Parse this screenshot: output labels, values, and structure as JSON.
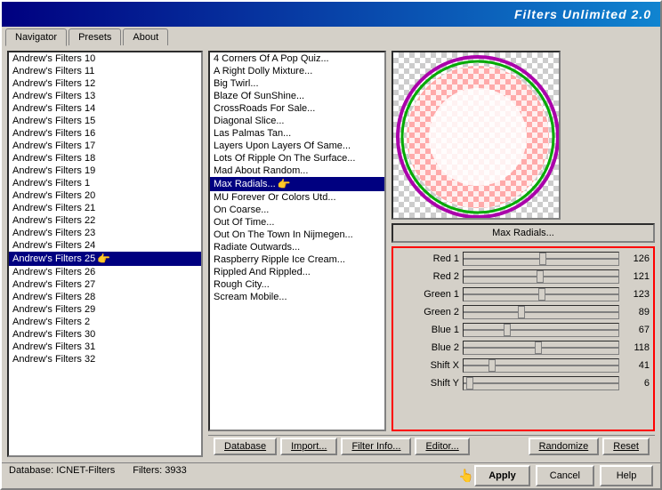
{
  "title": "Filters Unlimited 2.0",
  "tabs": [
    {
      "id": "navigator",
      "label": "Navigator"
    },
    {
      "id": "presets",
      "label": "Presets"
    },
    {
      "id": "about",
      "label": "About"
    }
  ],
  "activeTab": "navigator",
  "leftList": {
    "items": [
      {
        "label": "Andrew's Filters 10",
        "hasArrow": false
      },
      {
        "label": "Andrew's Filters 11",
        "hasArrow": false
      },
      {
        "label": "Andrew's Filters 12",
        "hasArrow": false
      },
      {
        "label": "Andrew's Filters 13",
        "hasArrow": false
      },
      {
        "label": "Andrew's Filters 14",
        "hasArrow": false
      },
      {
        "label": "Andrew's Filters 15",
        "hasArrow": false
      },
      {
        "label": "Andrew's Filters 16",
        "hasArrow": false
      },
      {
        "label": "Andrew's Filters 17",
        "hasArrow": false
      },
      {
        "label": "Andrew's Filters 18",
        "hasArrow": false
      },
      {
        "label": "Andrew's Filters 19",
        "hasArrow": false
      },
      {
        "label": "Andrew's Filters 1",
        "hasArrow": false
      },
      {
        "label": "Andrew's Filters 20",
        "hasArrow": false
      },
      {
        "label": "Andrew's Filters 21",
        "hasArrow": false
      },
      {
        "label": "Andrew's Filters 22",
        "hasArrow": false
      },
      {
        "label": "Andrew's Filters 23",
        "hasArrow": false
      },
      {
        "label": "Andrew's Filters 24",
        "hasArrow": false
      },
      {
        "label": "Andrew's Filters 25",
        "hasArrow": true,
        "selected": true
      },
      {
        "label": "Andrew's Filters 26",
        "hasArrow": false
      },
      {
        "label": "Andrew's Filters 27",
        "hasArrow": false
      },
      {
        "label": "Andrew's Filters 28",
        "hasArrow": false
      },
      {
        "label": "Andrew's Filters 29",
        "hasArrow": false
      },
      {
        "label": "Andrew's Filters 2",
        "hasArrow": false
      },
      {
        "label": "Andrew's Filters 30",
        "hasArrow": false
      },
      {
        "label": "Andrew's Filters 31",
        "hasArrow": false
      },
      {
        "label": "Andrew's Filters 32",
        "hasArrow": false
      }
    ]
  },
  "filterList": {
    "items": [
      {
        "label": "4 Corners Of A Pop Quiz..."
      },
      {
        "label": "A Right Dolly Mixture..."
      },
      {
        "label": "Big Twirl..."
      },
      {
        "label": "Blaze Of SunShine..."
      },
      {
        "label": "CrossRoads For Sale..."
      },
      {
        "label": "Diagonal Slice..."
      },
      {
        "label": "Las Palmas Tan..."
      },
      {
        "label": "Layers Upon Layers Of Same...",
        "selected": false
      },
      {
        "label": "Lots Of Ripple On The Surface..."
      },
      {
        "label": "Mad About Random..."
      },
      {
        "label": "Max Radials...",
        "selected": true
      },
      {
        "label": "MU Forever Or Colors Utd..."
      },
      {
        "label": "On Coarse..."
      },
      {
        "label": "Out Of Time..."
      },
      {
        "label": "Out On The Town In Nijmegen..."
      },
      {
        "label": "Radiate Outwards..."
      },
      {
        "label": "Raspberry Ripple Ice Cream..."
      },
      {
        "label": "Rippled And Rippled..."
      },
      {
        "label": "Rough City..."
      },
      {
        "label": "Scream Mobile..."
      }
    ]
  },
  "filterName": "Max Radials...",
  "params": [
    {
      "label": "Red 1",
      "value": 126,
      "percent": 49
    },
    {
      "label": "Red 2",
      "value": 121,
      "percent": 47
    },
    {
      "label": "Green 1",
      "value": 123,
      "percent": 48
    },
    {
      "label": "Green 2",
      "value": 89,
      "percent": 35
    },
    {
      "label": "Blue 1",
      "value": 67,
      "percent": 26
    },
    {
      "label": "Blue 2",
      "value": 118,
      "percent": 46
    },
    {
      "label": "Shift X",
      "value": 41,
      "percent": 16
    },
    {
      "label": "Shift Y",
      "value": 6,
      "percent": 2
    }
  ],
  "toolbar": {
    "database": "Database",
    "import": "Import...",
    "filterInfo": "Filter Info...",
    "editor": "Editor...",
    "randomize": "Randomize",
    "reset": "Reset"
  },
  "statusBar": {
    "dbLabel": "Database:",
    "dbValue": "ICNET-Filters",
    "filtersLabel": "Filters:",
    "filtersValue": "3933"
  },
  "actions": {
    "apply": "Apply",
    "cancel": "Cancel",
    "help": "Help"
  }
}
